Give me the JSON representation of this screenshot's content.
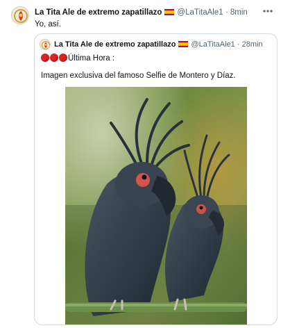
{
  "tweet": {
    "author_name": "La Tita Ale de extremo zapatillazo",
    "handle": "@LaTitaAle1",
    "separator": "·",
    "time": "8min",
    "text": "Yo, así."
  },
  "quoted_tweet": {
    "author_name": "La Tita Ale de extremo zapatillazo",
    "handle": "@LaTitaAle1",
    "separator": "·",
    "time": "28min",
    "line1": "Última Hora :",
    "line2": "Imagen exclusiva del famoso Selfie de Montero y Díaz."
  },
  "icons": {
    "more": "more-horizontal-icon",
    "flag": "spain-flag-icon",
    "alert_dot": "red-circle-emoji"
  },
  "colors": {
    "text": "#0f1419",
    "muted": "#536471",
    "border": "#cfd9de",
    "alert_red": "#d72323"
  }
}
